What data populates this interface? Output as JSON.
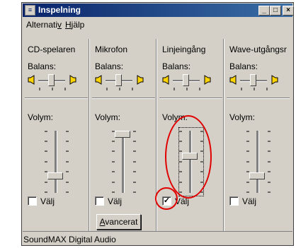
{
  "window": {
    "title": "Inspelning",
    "app_icon": "mixer-icon",
    "buttons": {
      "minimize": "_",
      "maximize": "□",
      "close": "×"
    }
  },
  "menubar": {
    "alternativ": "Alternativ",
    "hjalp": "Hjälp"
  },
  "columns": [
    {
      "name": "CD-spelaren",
      "balance_label": "Balans:",
      "volume_label": "Volym:",
      "volume_level": 0.25,
      "select_label": "Välj",
      "selected": false
    },
    {
      "name": "Mikrofon",
      "balance_label": "Balans:",
      "volume_label": "Volym:",
      "volume_level": 1.0,
      "select_label": "Välj",
      "selected": false
    },
    {
      "name": "Linjeingång",
      "balance_label": "Balans:",
      "volume_label": "Volym:",
      "volume_level": 0.6,
      "select_label": "Välj",
      "selected": true
    },
    {
      "name": "Wave-utgångsr",
      "balance_label": "Balans:",
      "volume_label": "Volym:",
      "volume_level": 0.25,
      "select_label": "Välj",
      "selected": false
    }
  ],
  "advanced_button": "Avancerat",
  "statusbar": {
    "text": "SoundMAX Digital Audio"
  },
  "annotation_color": "#e00000"
}
